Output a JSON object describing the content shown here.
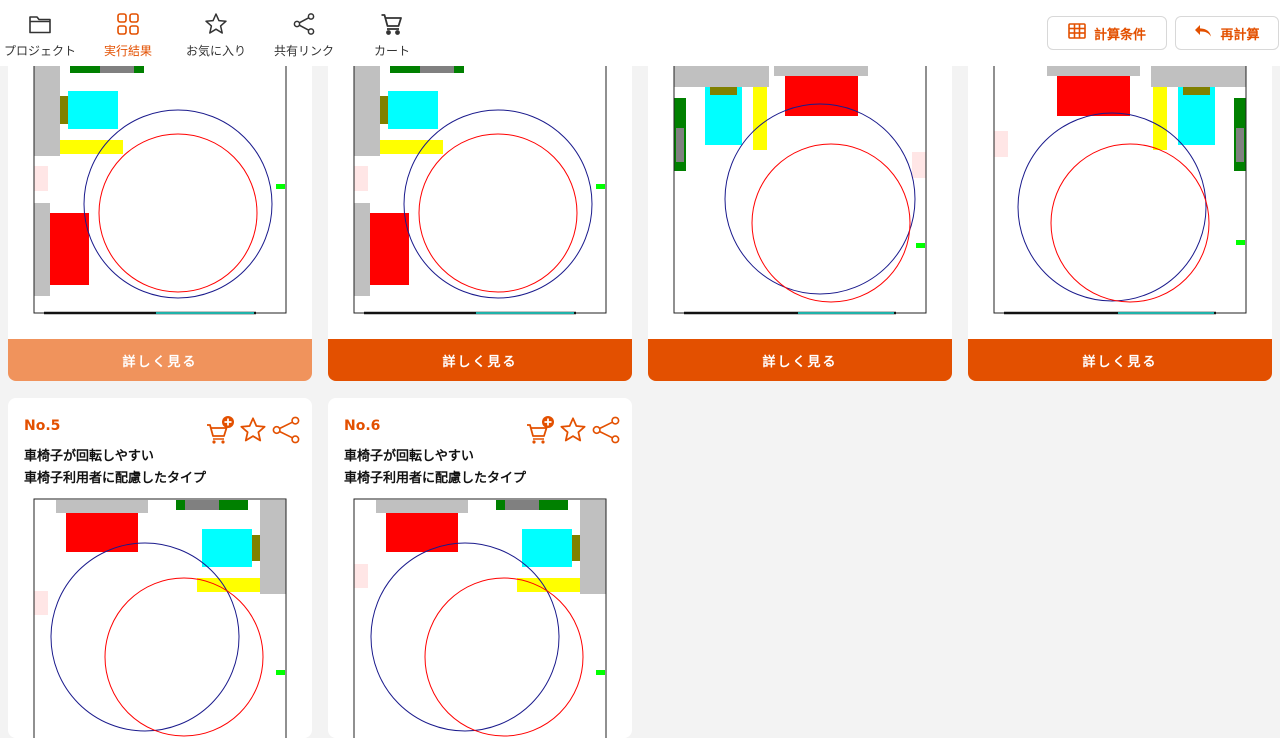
{
  "nav": {
    "items": [
      {
        "label": "プロジェクト",
        "icon": "folder-icon"
      },
      {
        "label": "実行結果",
        "icon": "grid-icon"
      },
      {
        "label": "お気に入り",
        "icon": "star-icon"
      },
      {
        "label": "共有リンク",
        "icon": "share-icon"
      },
      {
        "label": "カート",
        "icon": "cart-icon"
      }
    ],
    "active_index": 1
  },
  "actions": {
    "conditions_label": "計算条件",
    "recalc_label": "再計算"
  },
  "cards": [
    {
      "more_label": "詳しく見る"
    },
    {
      "more_label": "詳しく見る"
    },
    {
      "more_label": "詳しく見る"
    },
    {
      "more_label": "詳しく見る"
    },
    {
      "number": "No.5",
      "desc_line1": "車椅子が回転しやすい",
      "desc_line2": "車椅子利用者に配慮したタイプ"
    },
    {
      "number": "No.6",
      "desc_line1": "車椅子が回転しやすい",
      "desc_line2": "車椅子利用者に配慮したタイプ"
    }
  ],
  "colors": {
    "accent": "#e35000",
    "accent_light": "#f0935c"
  }
}
